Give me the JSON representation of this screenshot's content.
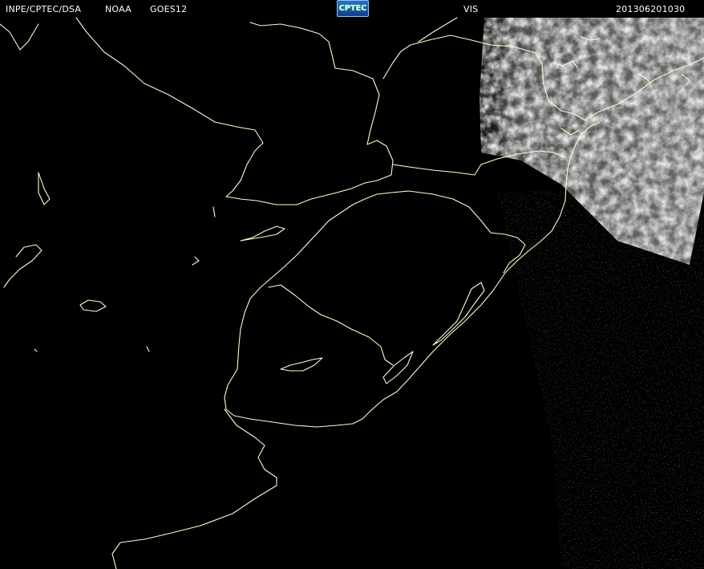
{
  "header": {
    "agency": "INPE/CPTEC/DSA",
    "satellite_operator": "NOAA",
    "satellite": "GOES12",
    "channel": "VIS",
    "timestamp": "201306201030"
  },
  "logo": {
    "text": "CPTEC"
  },
  "colors": {
    "background": "#000000",
    "borders": "#fffbd0",
    "header_text": "#ffffff",
    "cloud": "#bdbdbd",
    "logo_bg": "#1c5bb0"
  }
}
